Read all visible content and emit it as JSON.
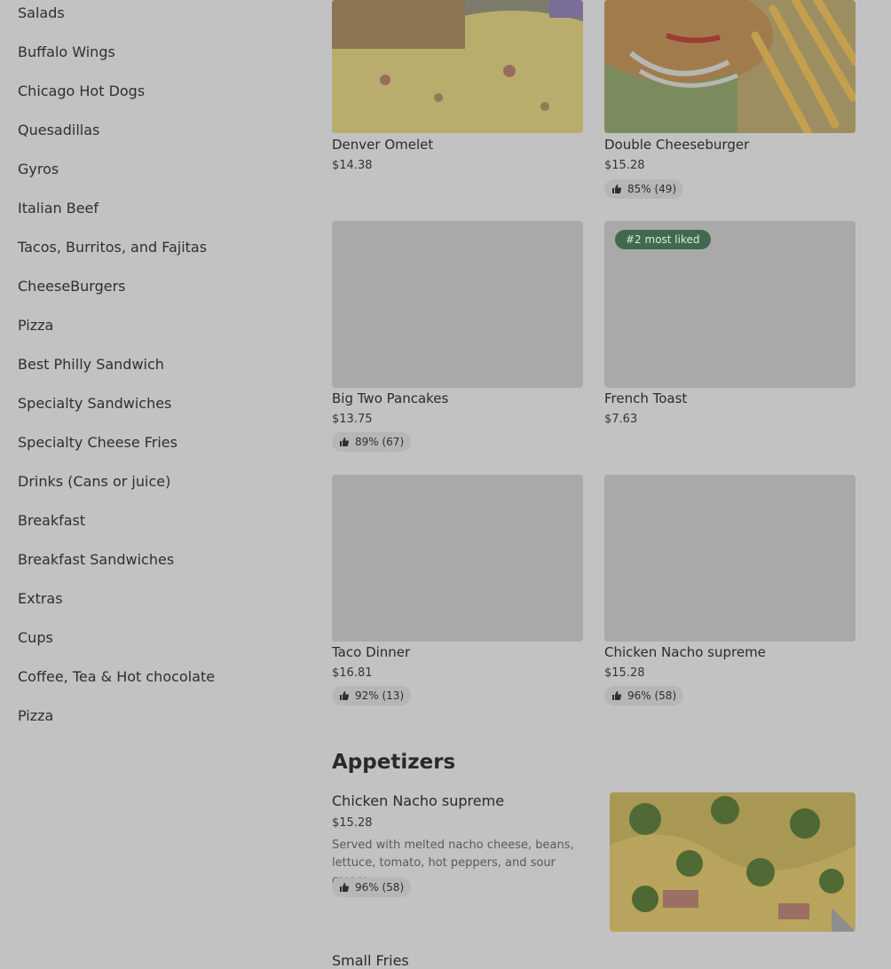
{
  "sidebar": {
    "items": [
      "Salads",
      "Buffalo Wings",
      "Chicago Hot Dogs",
      "Quesadillas",
      "Gyros",
      "Italian Beef",
      "Tacos, Burritos, and Fajitas",
      "CheeseBurgers",
      "Pizza",
      "Best Philly Sandwich",
      "Specialty Sandwiches",
      "Specialty Cheese Fries",
      "Drinks (Cans or juice)",
      "Breakfast",
      "Breakfast Sandwiches",
      "Extras",
      "Cups",
      "Coffee, Tea & Hot chocolate",
      "Pizza"
    ]
  },
  "cards": [
    {
      "name": "Denver Omelet",
      "price": "$14.38",
      "rating": ""
    },
    {
      "name": "Double Cheeseburger",
      "price": "$15.28",
      "rating": "85% (49)"
    },
    {
      "name": "Big Two Pancakes",
      "price": "$13.75",
      "rating": "89% (67)"
    },
    {
      "name": "French Toast",
      "price": "$7.63",
      "rating": "",
      "badge": "#2 most liked"
    },
    {
      "name": "Taco Dinner",
      "price": "$16.81",
      "rating": "92% (13)"
    },
    {
      "name": "Chicken Nacho supreme",
      "price": "$15.28",
      "rating": "96% (58)"
    }
  ],
  "section": {
    "title": "Appetizers"
  },
  "featured": {
    "name": "Chicken Nacho supreme",
    "price": "$15.28",
    "description": "Served with melted nacho cheese, beans, lettuce, tomato, hot peppers, and sour cream.",
    "rating": "96% (58)"
  },
  "next_item": {
    "name": "Small Fries"
  },
  "icons": {
    "rating": "thumbs-up-icon"
  }
}
